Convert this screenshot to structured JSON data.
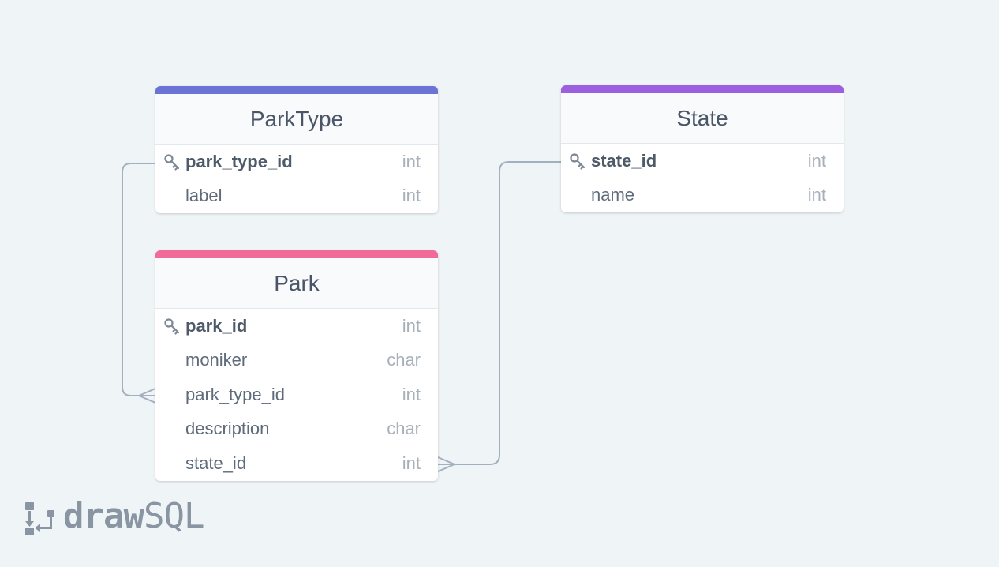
{
  "tables": [
    {
      "name": "ParkType",
      "accent_color": "#6b74d6",
      "columns": [
        {
          "name": "park_type_id",
          "type": "int",
          "primary_key": true
        },
        {
          "name": "label",
          "type": "int",
          "primary_key": false
        }
      ]
    },
    {
      "name": "State",
      "accent_color": "#9b5fe0",
      "columns": [
        {
          "name": "state_id",
          "type": "int",
          "primary_key": true
        },
        {
          "name": "name",
          "type": "int",
          "primary_key": false
        }
      ]
    },
    {
      "name": "Park",
      "accent_color": "#f06b97",
      "columns": [
        {
          "name": "park_id",
          "type": "int",
          "primary_key": true
        },
        {
          "name": "moniker",
          "type": "char",
          "primary_key": false
        },
        {
          "name": "park_type_id",
          "type": "int",
          "primary_key": false
        },
        {
          "name": "description",
          "type": "char",
          "primary_key": false
        },
        {
          "name": "state_id",
          "type": "int",
          "primary_key": false
        }
      ]
    }
  ],
  "relationships": [
    {
      "from_table": "ParkType",
      "from_column": "park_type_id",
      "to_table": "Park",
      "to_column": "park_type_id",
      "cardinality": "one-to-many"
    },
    {
      "from_table": "State",
      "from_column": "state_id",
      "to_table": "Park",
      "to_column": "state_id",
      "cardinality": "one-to-many"
    }
  ],
  "connector_color": "#a3b0bd",
  "branding": {
    "logo_bold": "draw",
    "logo_light": "SQL",
    "logo_color": "#8a95a3"
  }
}
